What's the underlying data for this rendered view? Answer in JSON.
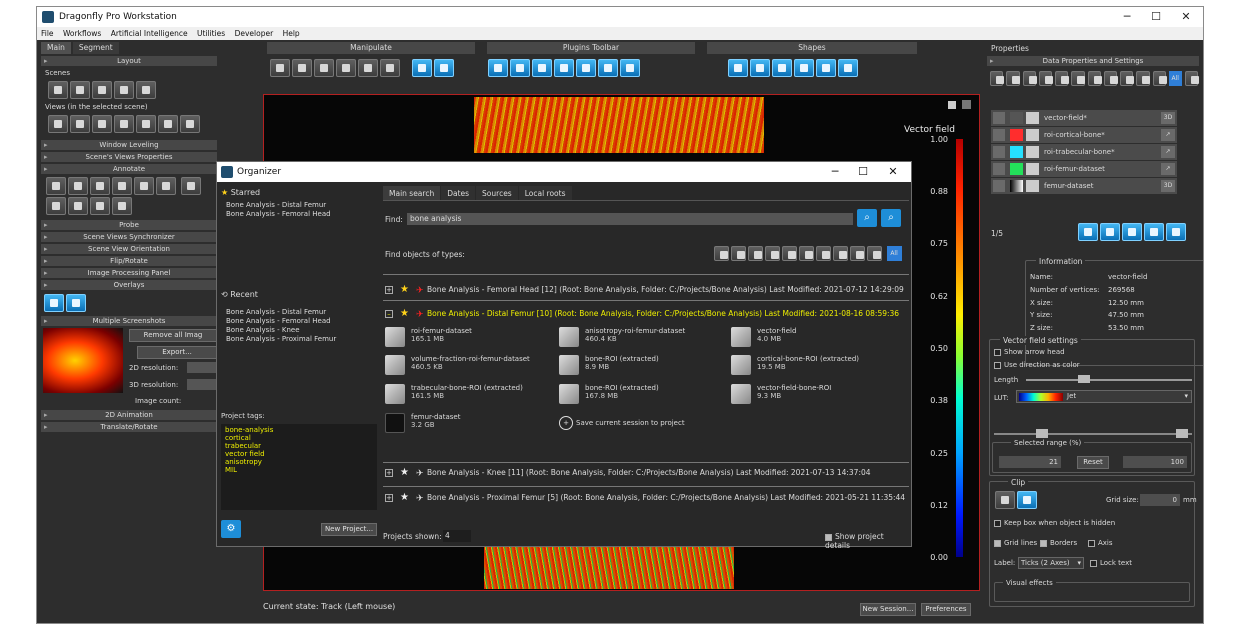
{
  "window": {
    "title": "Dragonfly Pro Workstation",
    "min": "─",
    "max": "☐",
    "close": "✕"
  },
  "menu": [
    "File",
    "Workflows",
    "Artificial Intelligence",
    "Utilities",
    "Developer",
    "Help"
  ],
  "left": {
    "tabs": [
      "Main",
      "Segment"
    ],
    "layout": "Layout",
    "scenes": "Scenes",
    "views": "Views (in the selected scene)",
    "window_leveling": "Window Leveling",
    "scene_views_properties": "Scene's Views Properties",
    "annotate": "Annotate",
    "probe": "Probe",
    "sync": "Scene Views Synchronizer",
    "orientation": "Scene View Orientation",
    "flip": "Flip/Rotate",
    "image_processing": "Image Processing Panel",
    "overlays": "Overlays",
    "multiple_screenshots": "Multiple Screenshots",
    "remove_all": "Remove all Imag",
    "export": "Export...",
    "res2d": "2D resolution:",
    "res3d": "3D resolution:",
    "image_count": "Image count:",
    "anim2d": "2D Animation",
    "translate": "Translate/Rotate"
  },
  "toolbars": {
    "manipulate": "Manipulate",
    "plugins": "Plugins Toolbar",
    "shapes": "Shapes"
  },
  "view": {
    "colorbar_title": "Vector field",
    "ticks": [
      "1.00",
      "0.88",
      "0.75",
      "0.62",
      "0.50",
      "0.38",
      "0.25",
      "0.12",
      "0.00"
    ]
  },
  "status": {
    "current_state": "Current state: Track (Left mouse)",
    "new_session": "New Session...",
    "preferences": "Preferences"
  },
  "right": {
    "properties": "Properties",
    "data_props": "Data Properties and Settings",
    "all": "All",
    "layers": [
      {
        "name": "vector-field*",
        "color": "#555",
        "d": "3D"
      },
      {
        "name": "roi-cortical-bone*",
        "color": "#ff2d2d",
        "d": "↗"
      },
      {
        "name": "roi-trabecular-bone*",
        "color": "#25e0ff",
        "d": "↗"
      },
      {
        "name": "roi-femur-dataset",
        "color": "#23e05a",
        "d": "↗"
      },
      {
        "name": "femur-dataset",
        "color": "#777",
        "d": "3D"
      }
    ],
    "page": "1/5",
    "info": {
      "title": "Information",
      "rows": [
        [
          "Name:",
          "vector-field"
        ],
        [
          "Number of vertices:",
          "269568"
        ],
        [
          "X size:",
          "12.50 mm"
        ],
        [
          "Y size:",
          "47.50 mm"
        ],
        [
          "Z size:",
          "53.50 mm"
        ]
      ]
    },
    "vf": {
      "title": "Vector field settings",
      "arrow": "Show arrow head",
      "color": "Use direction as color",
      "length": "Length",
      "lut": "LUT:",
      "lut_val": "Jet",
      "range": "Selected range (%)",
      "min": "21",
      "reset": "Reset",
      "max": "100"
    },
    "clip": {
      "title": "Clip",
      "grid_size": "Grid size:",
      "grid_val": "0",
      "mm": "mm",
      "keep": "Keep box when object is hidden",
      "grid_lines": "Grid lines",
      "borders": "Borders",
      "axis": "Axis",
      "label": "Label:",
      "label_val": "Ticks (2 Axes)",
      "lock": "Lock text",
      "visual": "Visual effects"
    }
  },
  "organizer": {
    "title": "Organizer",
    "starred": "Starred",
    "starred_items": [
      "Bone Analysis - Distal Femur",
      "Bone Analysis - Femoral Head"
    ],
    "recent": "Recent",
    "recent_items": [
      "Bone Analysis - Distal Femur",
      "Bone Analysis - Femoral Head",
      "Bone Analysis - Knee",
      "Bone Analysis - Proximal Femur"
    ],
    "tags_title": "Project tags:",
    "tags": [
      "bone-analysis",
      "cortical",
      "trabecular",
      "vector field",
      "anisotropy",
      "MIL"
    ],
    "new_project": "New Project...",
    "tabs": [
      "Main search",
      "Dates",
      "Sources",
      "Local roots"
    ],
    "find": "Find:",
    "query": "bone analysis",
    "types": "Find objects of types:",
    "all": "All",
    "projects": [
      {
        "text": "Bone Analysis - Femoral Head [12] (Root: Bone Analysis, Folder: C:/Projects/Bone Analysis) Last Modified: 2021-07-12 14:29:09",
        "starred": true,
        "open": false
      },
      {
        "text": "Bone Analysis - Distal Femur [10] (Root: Bone Analysis, Folder: C:/Projects/Bone Analysis) Last Modified: 2021-08-16 08:59:36",
        "starred": true,
        "open": true
      },
      {
        "text": "Bone Analysis - Knee [11] (Root: Bone Analysis, Folder: C:/Projects/Bone Analysis) Last Modified: 2021-07-13 14:37:04",
        "starred": false,
        "open": false
      },
      {
        "text": "Bone Analysis - Proximal Femur [5] (Root: Bone Analysis, Folder: C:/Projects/Bone Analysis) Last Modified: 2021-05-21 11:35:44",
        "starred": false,
        "open": false
      }
    ],
    "items": [
      [
        "roi-femur-dataset",
        "165.1 MB"
      ],
      [
        "anisotropy-roi-femur-dataset",
        "460.4 KB"
      ],
      [
        "vector-field",
        "4.0 MB"
      ],
      [
        "volume-fraction-roi-femur-dataset",
        "460.5 KB"
      ],
      [
        "bone-ROI (extracted)",
        "8.9 MB"
      ],
      [
        "cortical-bone-ROI (extracted)",
        "19.5 MB"
      ],
      [
        "trabecular-bone-ROI (extracted)",
        "161.5 MB"
      ],
      [
        "bone-ROI (extracted)",
        "167.8 MB"
      ],
      [
        "vector-field-bone-ROI",
        "9.3 MB"
      ],
      [
        "femur-dataset",
        "3.2 GB"
      ]
    ],
    "save": "Save current session to project",
    "shown": "Projects shown:",
    "shown_val": "4",
    "details": "Show project details"
  }
}
